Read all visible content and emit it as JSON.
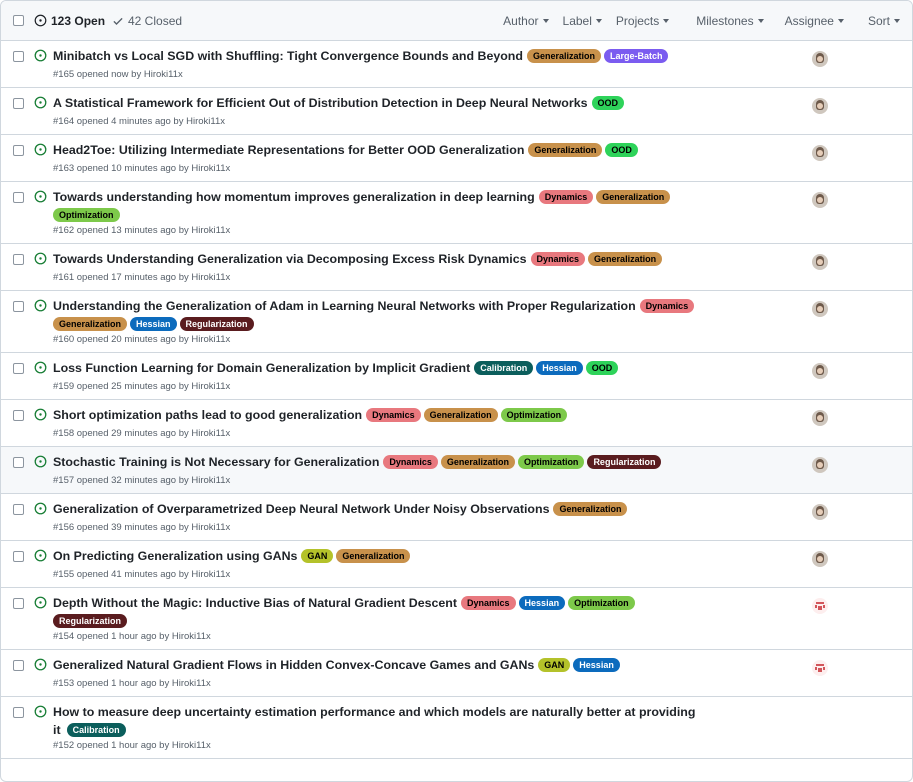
{
  "header": {
    "open_label": "123 Open",
    "closed_label": "42 Closed",
    "filters": [
      "Author",
      "Label",
      "Projects",
      "Milestones",
      "Assignee",
      "Sort"
    ]
  },
  "label_colors": {
    "Generalization": {
      "bg": "#c8914b",
      "fg": "#000000"
    },
    "Large-Batch": {
      "bg": "#7b5cf0",
      "fg": "#ffffff"
    },
    "OOD": {
      "bg": "#2ed35a",
      "fg": "#000000"
    },
    "Dynamics": {
      "bg": "#e8787e",
      "fg": "#000000"
    },
    "Optimization": {
      "bg": "#7dc94a",
      "fg": "#000000"
    },
    "Hessian": {
      "bg": "#0c6bbd",
      "fg": "#ffffff"
    },
    "Regularization": {
      "bg": "#5a1c1f",
      "fg": "#ffffff"
    },
    "Calibration": {
      "bg": "#0b5e5c",
      "fg": "#ffffff"
    },
    "GAN": {
      "bg": "#b4c22a",
      "fg": "#000000"
    }
  },
  "issues": [
    {
      "title": "Minibatch vs Local SGD with Shuffling: Tight Convergence Bounds and Beyond",
      "labels": [
        "Generalization",
        "Large-Batch"
      ],
      "meta": "#165 opened now by Hiroki11x",
      "avatar": "person-avatar-icon"
    },
    {
      "title": "A Statistical Framework for Efficient Out of Distribution Detection in Deep Neural Networks",
      "labels": [
        "OOD"
      ],
      "meta": "#164 opened 4 minutes ago by Hiroki11x",
      "avatar": "person-avatar-icon"
    },
    {
      "title": "Head2Toe: Utilizing Intermediate Representations for Better OOD Generalization",
      "labels": [
        "Generalization",
        "OOD"
      ],
      "meta": "#163 opened 10 minutes ago by Hiroki11x",
      "avatar": "person-avatar-icon"
    },
    {
      "title": "Towards understanding how momentum improves generalization in deep learning",
      "labels": [
        "Dynamics",
        "Generalization"
      ],
      "labels2": [
        "Optimization"
      ],
      "meta": "#162 opened 13 minutes ago by Hiroki11x",
      "avatar": "person-avatar-icon"
    },
    {
      "title": "Towards Understanding Generalization via Decomposing Excess Risk Dynamics",
      "labels": [
        "Dynamics",
        "Generalization"
      ],
      "meta": "#161 opened 17 minutes ago by Hiroki11x",
      "avatar": "person-avatar-icon"
    },
    {
      "title": "Understanding the Generalization of Adam in Learning Neural Networks with Proper Regularization",
      "labels": [
        "Dynamics"
      ],
      "labels2": [
        "Generalization",
        "Hessian",
        "Regularization"
      ],
      "meta": "#160 opened 20 minutes ago by Hiroki11x",
      "avatar": "person-avatar-icon"
    },
    {
      "title": "Loss Function Learning for Domain Generalization by Implicit Gradient",
      "labels": [
        "Calibration",
        "Hessian",
        "OOD"
      ],
      "meta": "#159 opened 25 minutes ago by Hiroki11x",
      "avatar": "person-avatar-icon"
    },
    {
      "title": "Short optimization paths lead to good generalization",
      "labels": [
        "Dynamics",
        "Generalization",
        "Optimization"
      ],
      "meta": "#158 opened 29 minutes ago by Hiroki11x",
      "avatar": "person-avatar-icon"
    },
    {
      "title": "Stochastic Training is Not Necessary for Generalization",
      "labels": [
        "Dynamics",
        "Generalization",
        "Optimization",
        "Regularization"
      ],
      "meta": "#157 opened 32 minutes ago by Hiroki11x",
      "avatar": "person-avatar-icon"
    },
    {
      "title": "Generalization of Overparametrized Deep Neural Network Under Noisy Observations",
      "labels": [
        "Generalization"
      ],
      "meta": "#156 opened 39 minutes ago by Hiroki11x",
      "avatar": "person-avatar-icon"
    },
    {
      "title": "On Predicting Generalization using GANs",
      "labels": [
        "GAN",
        "Generalization"
      ],
      "meta": "#155 opened 41 minutes ago by Hiroki11x",
      "avatar": "person-avatar-icon"
    },
    {
      "title": "Depth Without the Magic: Inductive Bias of Natural Gradient Descent",
      "labels": [
        "Dynamics",
        "Hessian",
        "Optimization"
      ],
      "labels2": [
        "Regularization"
      ],
      "meta": "#154 opened 1 hour ago by Hiroki11x",
      "avatar": "pixel-avatar-icon"
    },
    {
      "title": "Generalized Natural Gradient Flows in Hidden Convex-Concave Games and GANs",
      "labels": [
        "GAN",
        "Hessian"
      ],
      "meta": "#153 opened 1 hour ago by Hiroki11x",
      "avatar": "pixel-avatar-icon"
    },
    {
      "title": "How to measure deep uncertainty estimation performance and which models are naturally better at providing",
      "title2": "it",
      "labels": [],
      "labels2": [
        "Calibration"
      ],
      "meta": "#152 opened 1 hour ago by Hiroki11x",
      "avatar": ""
    }
  ]
}
